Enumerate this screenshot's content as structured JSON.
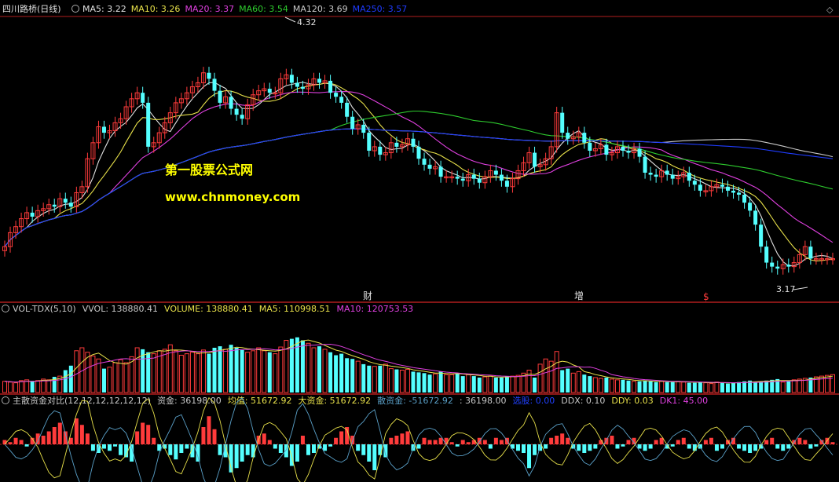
{
  "colors": {
    "background": "#000000",
    "up": "#ff3b3b",
    "down": "#54ffff",
    "separator": "#b01e1e",
    "title": "#e0e0e0",
    "MA5": "#e0e0e0",
    "MA10": "#e8e14a",
    "MA20": "#e040e0",
    "MA60": "#2ecc2e",
    "MA120": "#c8c8c8",
    "MA250": "#1f3cff",
    "watermark": "#ffff00"
  },
  "price_panel": {
    "title": "四川路桥(日线)",
    "indicators": [
      {
        "name": "MA5",
        "label": "MA5: 3.22",
        "color": "#e0e0e0"
      },
      {
        "name": "MA10",
        "label": "MA10: 3.26",
        "color": "#e8e14a"
      },
      {
        "name": "MA20",
        "label": "MA20: 3.37",
        "color": "#e040e0"
      },
      {
        "name": "MA60",
        "label": "MA60: 3.54",
        "color": "#2ecc2e"
      },
      {
        "name": "MA120",
        "label": "MA120: 3.69",
        "color": "#c8c8c8"
      },
      {
        "name": "MA250",
        "label": "MA250: 3.57",
        "color": "#1f3cff"
      }
    ],
    "high_label": "4.32",
    "low_label": "3.17",
    "watermark_title": "第一股票公式网",
    "watermark_url": "www.chnmoney.com",
    "event_markers": [
      "财",
      "增",
      "$"
    ]
  },
  "volume_panel": {
    "labels": [
      {
        "text": "VOL-TDX(5,10)",
        "color": "#c8c8c8"
      },
      {
        "text": "VVOL: 138880.41",
        "color": "#c8c8c8"
      },
      {
        "text": "VOLUME: 138880.41",
        "color": "#e8e14a"
      },
      {
        "text": "MA5: 110998.51",
        "color": "#e8e14a"
      },
      {
        "text": "MA10: 120753.53",
        "color": "#e040e0"
      }
    ]
  },
  "funds_panel": {
    "labels": [
      {
        "text": "主散资金对比(12,12,12,12,12,12)",
        "color": "#c8c8c8"
      },
      {
        "text": "资金: 36198.00",
        "color": "#c8c8c8"
      },
      {
        "text": "均值: 51672.92",
        "color": "#e8e14a"
      },
      {
        "text": "大资金: 51672.92",
        "color": "#e8e14a"
      },
      {
        "text": "散资金: -51672.92",
        "color": "#5aa0c8"
      },
      {
        "text": ": 36198.00",
        "color": "#c8c8c8"
      },
      {
        "text": "选股: 0.00",
        "color": "#2040ff"
      },
      {
        "text": "DDX: 0.10",
        "color": "#c8c8c8"
      },
      {
        "text": "DDY: 0.03",
        "color": "#e8e14a"
      },
      {
        "text": "DK1: 45.00",
        "color": "#e040e0"
      }
    ]
  },
  "chart_data": [
    {
      "type": "candlestick",
      "title": "四川路桥(日线)",
      "x": [
        0,
        1,
        2,
        3,
        4,
        5,
        6,
        7,
        8,
        9,
        10,
        11,
        12,
        13,
        14,
        15,
        16,
        17,
        18,
        19,
        20,
        21,
        22,
        23,
        24,
        25,
        26,
        27,
        28,
        29,
        30,
        31,
        32,
        33,
        34,
        35,
        36,
        37,
        38,
        39,
        40,
        41,
        42,
        43,
        44,
        45,
        46,
        47,
        48,
        49,
        50,
        51,
        52,
        53,
        54,
        55,
        56,
        57,
        58,
        59,
        60,
        61,
        62,
        63,
        64,
        65,
        66,
        67,
        68,
        69,
        70,
        71,
        72,
        73,
        74,
        75,
        76,
        77,
        78,
        79,
        80,
        81,
        82,
        83,
        84,
        85,
        86,
        87,
        88,
        89,
        90,
        91,
        92,
        93,
        94,
        95,
        96,
        97,
        98,
        99,
        100,
        101,
        102,
        103,
        104,
        105,
        106,
        107,
        108,
        109,
        110,
        111,
        112,
        113,
        114,
        115,
        116,
        117,
        118,
        119,
        120,
        121,
        122,
        123,
        124,
        125,
        126,
        127,
        128,
        129,
        130,
        131,
        132,
        133,
        134,
        135,
        136,
        137,
        138,
        139,
        140,
        141,
        142,
        143,
        144,
        145,
        146,
        147,
        148,
        149,
        150
      ],
      "close": [
        3.28,
        3.35,
        3.38,
        3.42,
        3.45,
        3.43,
        3.46,
        3.47,
        3.49,
        3.48,
        3.52,
        3.5,
        3.48,
        3.55,
        3.58,
        3.72,
        3.8,
        3.88,
        3.85,
        3.86,
        3.9,
        3.92,
        3.98,
        4.02,
        4.05,
        4.0,
        3.78,
        3.8,
        3.85,
        3.9,
        3.95,
        4.0,
        4.02,
        4.05,
        4.08,
        4.1,
        4.15,
        4.12,
        4.06,
        4.0,
        4.03,
        3.97,
        3.94,
        3.92,
        3.99,
        4.04,
        4.06,
        4.07,
        4.05,
        4.05,
        4.12,
        4.14,
        4.1,
        4.08,
        4.07,
        4.09,
        4.12,
        4.1,
        4.11,
        4.05,
        4.03,
        4.0,
        3.93,
        3.87,
        3.89,
        3.85,
        3.76,
        3.78,
        3.74,
        3.75,
        3.8,
        3.78,
        3.79,
        3.82,
        3.78,
        3.72,
        3.69,
        3.67,
        3.68,
        3.63,
        3.63,
        3.63,
        3.62,
        3.61,
        3.64,
        3.62,
        3.6,
        3.63,
        3.66,
        3.64,
        3.61,
        3.58,
        3.62,
        3.66,
        3.7,
        3.75,
        3.68,
        3.69,
        3.72,
        3.78,
        3.95,
        3.85,
        3.82,
        3.83,
        3.85,
        3.8,
        3.76,
        3.77,
        3.79,
        3.74,
        3.75,
        3.78,
        3.76,
        3.75,
        3.77,
        3.73,
        3.65,
        3.64,
        3.63,
        3.66,
        3.64,
        3.62,
        3.63,
        3.65,
        3.61,
        3.59,
        3.56,
        3.56,
        3.58,
        3.59,
        3.58,
        3.56,
        3.55,
        3.54,
        3.5,
        3.46,
        3.39,
        3.28,
        3.2,
        3.18,
        3.17,
        3.19,
        3.18,
        3.2,
        3.24,
        3.28,
        3.22,
        3.22,
        3.22,
        3.22,
        3.22
      ],
      "xlabel": "",
      "ylabel": "",
      "ylim": [
        3.1,
        4.42
      ]
    },
    {
      "type": "bar",
      "title": "VOL-TDX(5,10)",
      "values": [
        15,
        14,
        13,
        16,
        17,
        15,
        16,
        18,
        17,
        21,
        22,
        30,
        36,
        56,
        60,
        54,
        49,
        45,
        32,
        34,
        40,
        44,
        40,
        48,
        60,
        58,
        54,
        52,
        56,
        58,
        64,
        56,
        50,
        52,
        54,
        52,
        57,
        52,
        60,
        62,
        58,
        64,
        60,
        57,
        54,
        56,
        60,
        56,
        54,
        52,
        61,
        70,
        72,
        74,
        70,
        66,
        60,
        62,
        58,
        54,
        50,
        52,
        46,
        45,
        42,
        38,
        36,
        35,
        36,
        38,
        32,
        31,
        30,
        31,
        28,
        27,
        26,
        24,
        25,
        28,
        24,
        24,
        26,
        22,
        24,
        22,
        20,
        21,
        22,
        20,
        20,
        22,
        22,
        23,
        26,
        30,
        20,
        38,
        45,
        42,
        55,
        30,
        32,
        26,
        28,
        24,
        22,
        20,
        19,
        20,
        18,
        17,
        17,
        16,
        15,
        15,
        16,
        15,
        14,
        15,
        14,
        14,
        15,
        14,
        13,
        13,
        14,
        13,
        12,
        14,
        13,
        12,
        13,
        14,
        15,
        16,
        14,
        15,
        16,
        17,
        18,
        14,
        15,
        17,
        18,
        19,
        20,
        21,
        22,
        23,
        24
      ],
      "ylim": [
        0,
        100
      ]
    },
    {
      "type": "bar",
      "title": "主散资金对比(12,12,12,12,12,12)",
      "values": [
        0.2,
        0.1,
        0.3,
        0.2,
        -0.1,
        0.3,
        0.5,
        0.4,
        0.6,
        0.8,
        1.0,
        0.6,
        0.3,
        1.2,
        0.9,
        0.5,
        -0.3,
        -0.4,
        -0.2,
        -0.3,
        -0.1,
        -0.5,
        -0.6,
        -0.8,
        0.6,
        1.0,
        0.9,
        0.3,
        -0.3,
        -0.2,
        -0.5,
        -0.7,
        -0.4,
        -0.2,
        -0.6,
        -0.8,
        0.8,
        1.3,
        0.7,
        -0.5,
        -0.6,
        -1.3,
        -1.1,
        -0.8,
        -0.5,
        -0.6,
        0.4,
        0.5,
        0.2,
        -0.2,
        -0.4,
        -0.6,
        -1.0,
        -0.8,
        0.4,
        -0.5,
        -0.4,
        -0.2,
        -0.3,
        -0.1,
        0.3,
        0.6,
        0.8,
        0.4,
        -0.3,
        -0.5,
        -0.8,
        -1.2,
        -0.5,
        -0.6,
        0.3,
        0.4,
        0.5,
        0.6,
        -0.3,
        -0.2,
        0.3,
        0.2,
        0.2,
        0.3,
        0.3,
        0.1,
        -0.1,
        0.2,
        0.1,
        0.2,
        0.3,
        0.2,
        -0.2,
        0.3,
        0.2,
        0.3,
        -0.2,
        -0.3,
        -0.4,
        -1.1,
        -0.5,
        -0.3,
        -0.2,
        0.3,
        0.4,
        0.5,
        0.3,
        -0.2,
        -0.3,
        -0.4,
        -0.3,
        -0.2,
        0.2,
        0.3,
        0.4,
        -0.2,
        -0.1,
        0.2,
        0.3,
        -0.2,
        -0.3,
        -0.2,
        0.2,
        0.3,
        -0.2,
        -0.1,
        0.2,
        0.3,
        -0.2,
        -0.3,
        -0.2,
        0.2,
        0.3,
        -0.3,
        -0.2,
        0.2,
        0.3,
        -0.2,
        -0.3,
        -0.4,
        -0.3,
        -0.2,
        0.2,
        0.3,
        -0.2,
        -0.3,
        -0.2,
        0.2,
        0.3,
        0.2,
        -0.2,
        -0.1,
        0.2,
        0.3,
        0.1
      ],
      "ylim": [
        -1.6,
        1.6
      ]
    }
  ]
}
